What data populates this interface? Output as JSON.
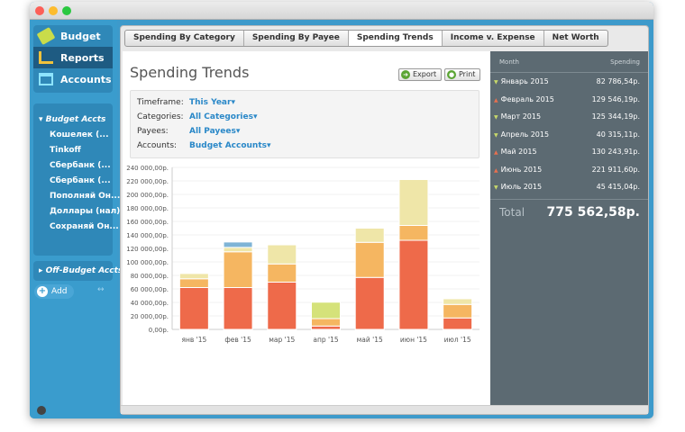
{
  "sidebar": {
    "nav": [
      {
        "label": "Budget"
      },
      {
        "label": "Reports"
      },
      {
        "label": "Accounts"
      }
    ],
    "budget_header": "Budget Accts",
    "accounts": [
      "Кошелек (...",
      "Tinkoff",
      "Сбербанк (...",
      "Сбербанк (...",
      "Пополняй Он...",
      "Доллары (нал)",
      "Сохраняй Он..."
    ],
    "off_budget_header": "Off-Budget Accts",
    "add_label": "Add"
  },
  "tabs": [
    "Spending By Category",
    "Spending By Payee",
    "Spending Trends",
    "Income v. Expense",
    "Net Worth"
  ],
  "main": {
    "title": "Spending Trends",
    "export_label": "Export",
    "print_label": "Print",
    "filters": [
      {
        "label": "Timeframe:",
        "value": "This Year"
      },
      {
        "label": "Categories:",
        "value": "All Categories"
      },
      {
        "label": "Payees:",
        "value": "All Payees"
      },
      {
        "label": "Accounts:",
        "value": "Budget Accounts"
      }
    ]
  },
  "summary": {
    "col_month": "Month",
    "col_spending": "Spending",
    "rows": [
      {
        "month": "Январь 2015",
        "amount": "82 786,54р.",
        "trend": "down"
      },
      {
        "month": "Февраль 2015",
        "amount": "129 546,19р.",
        "trend": "up"
      },
      {
        "month": "Март 2015",
        "amount": "125 344,19р.",
        "trend": "down"
      },
      {
        "month": "Апрель 2015",
        "amount": "40 315,11р.",
        "trend": "down"
      },
      {
        "month": "Май 2015",
        "amount": "130 243,91р.",
        "trend": "up"
      },
      {
        "month": "Июнь 2015",
        "amount": "221 911,60р.",
        "trend": "up"
      },
      {
        "month": "Июль 2015",
        "amount": "45 415,04р.",
        "trend": "down"
      }
    ],
    "total_label": "Total",
    "total": "775 562,58р."
  },
  "chart_data": {
    "type": "bar",
    "stacked": true,
    "categories": [
      "янв '15",
      "фев '15",
      "мар '15",
      "апр '15",
      "май '15",
      "июн '15",
      "июл '15"
    ],
    "yticks": [
      "0,00р.",
      "20 000,00р.",
      "40 000,00р.",
      "60 000,00р.",
      "80 000,00р.",
      "100 000,00р.",
      "120 000,00р.",
      "140 000,00р.",
      "160 000,00р.",
      "180 000,00р.",
      "200 000,00р.",
      "220 000,00р.",
      "240 000,00р."
    ],
    "ylim": [
      0,
      240000
    ],
    "series": [
      {
        "name": "s1",
        "color": "#ee6a4a",
        "values": [
          62000,
          62000,
          70000,
          5000,
          77000,
          132000,
          17000
        ]
      },
      {
        "name": "s2",
        "color": "#f5b661",
        "values": [
          13000,
          53000,
          27000,
          11000,
          52000,
          22000,
          20000
        ]
      },
      {
        "name": "s3",
        "color": "#efe6a8",
        "values": [
          7800,
          6500,
          28300,
          0,
          21000,
          68000,
          8400
        ]
      },
      {
        "name": "s4",
        "color": "#7fb4d6",
        "values": [
          0,
          8000,
          0,
          0,
          0,
          0,
          0
        ]
      },
      {
        "name": "s5",
        "color": "#d5e27a",
        "values": [
          0,
          0,
          0,
          24300,
          0,
          0,
          0
        ]
      }
    ]
  },
  "colors": {
    "up": "#e8704f",
    "down": "#c7d86a"
  }
}
